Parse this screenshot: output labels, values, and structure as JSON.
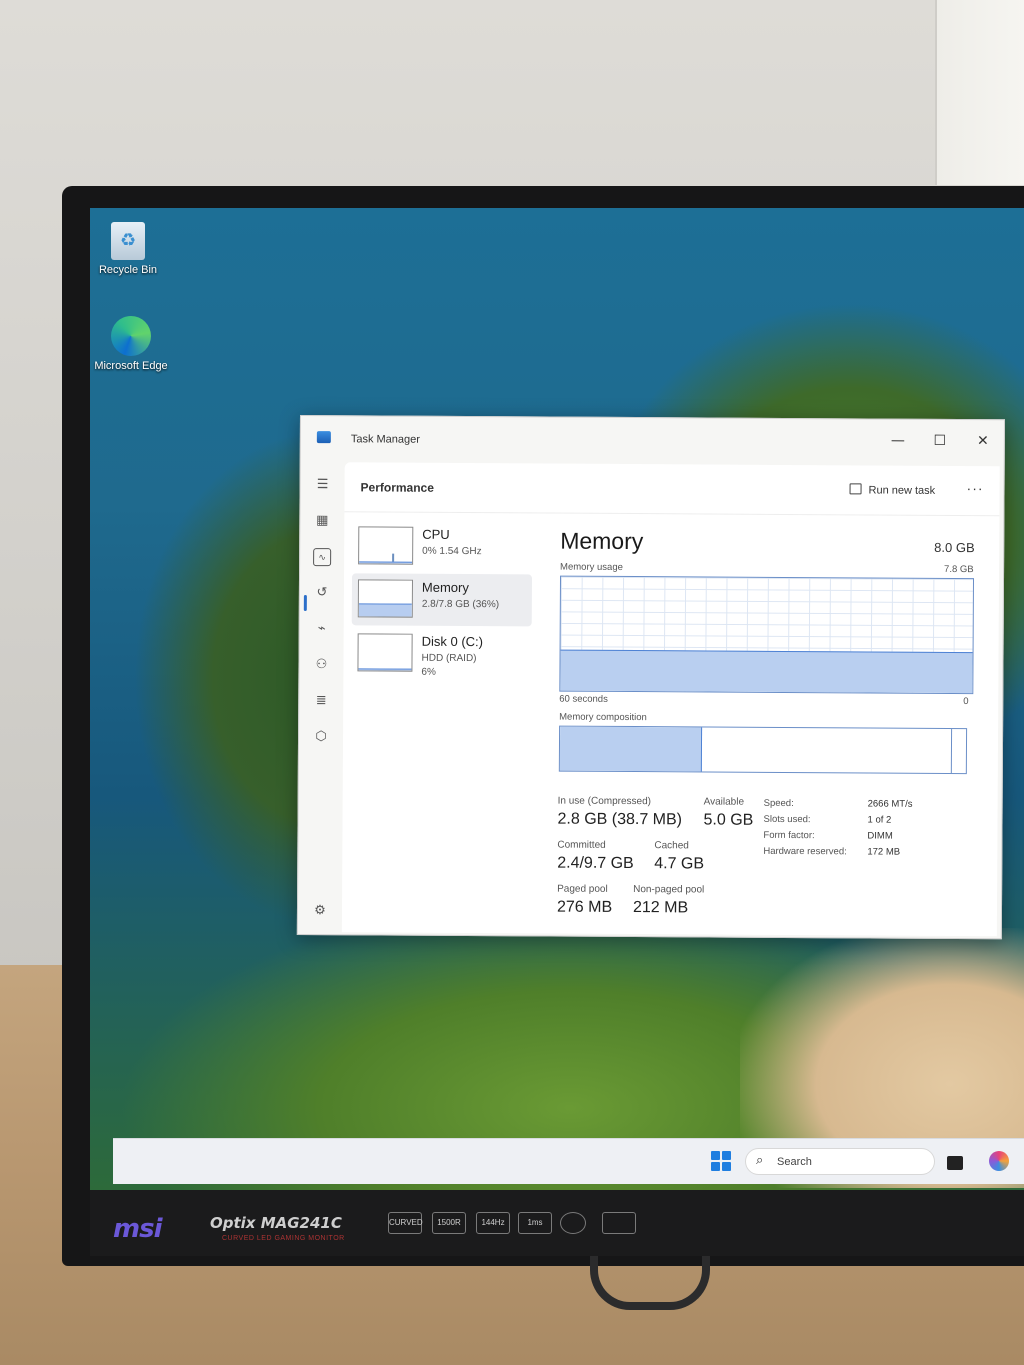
{
  "desktop": {
    "icons": [
      {
        "label": "Recycle Bin"
      },
      {
        "label": "Microsoft Edge"
      }
    ]
  },
  "window": {
    "title": "Task Manager",
    "controls": {
      "minimize": "—",
      "maximize": "☐",
      "close": "✕"
    }
  },
  "header": {
    "title": "Performance",
    "run_new_task": "Run new task",
    "more": "···"
  },
  "devices": [
    {
      "name": "CPU",
      "line1": "0%  1.54 GHz",
      "line2": "",
      "usage_fraction": 0.05
    },
    {
      "name": "Memory",
      "line1": "2.8/7.8 GB (36%)",
      "line2": "",
      "usage_fraction": 0.36,
      "selected": true
    },
    {
      "name": "Disk 0 (C:)",
      "line1": "HDD (RAID)",
      "line2": "6%",
      "usage_fraction": 0.06
    }
  ],
  "memory": {
    "title": "Memory",
    "total": "8.0 GB",
    "usage_label": "Memory usage",
    "usage_max": "7.8 GB",
    "time_span": "60 seconds",
    "axis_zero": "0",
    "usage_fraction": 0.36,
    "composition_label": "Memory composition",
    "in_use_fraction": 0.35,
    "stats": {
      "in_use_label": "In use (Compressed)",
      "in_use_value": "2.8 GB (38.7 MB)",
      "available_label": "Available",
      "available_value": "5.0 GB",
      "committed_label": "Committed",
      "committed_value": "2.4/9.7 GB",
      "cached_label": "Cached",
      "cached_value": "4.7 GB",
      "paged_label": "Paged pool",
      "paged_value": "276 MB",
      "nonpaged_label": "Non-paged pool",
      "nonpaged_value": "212 MB"
    },
    "specs": {
      "speed_label": "Speed:",
      "speed_value": "2666 MT/s",
      "slots_label": "Slots used:",
      "slots_value": "1 of 2",
      "form_label": "Form factor:",
      "form_value": "DIMM",
      "reserved_label": "Hardware reserved:",
      "reserved_value": "172 MB"
    }
  },
  "taskbar": {
    "search_placeholder": "Search"
  },
  "monitor": {
    "brand": "msi",
    "model": "Optix MAG241C",
    "model_sub": "CURVED LED GAMING MONITOR",
    "badges": [
      "CURVED",
      "1500R",
      "144Hz",
      "1ms",
      "",
      ""
    ]
  },
  "colors": {
    "accent": "#2c6fc9",
    "graph_fill": "#b9cff0",
    "graph_line": "#4e82d4"
  }
}
